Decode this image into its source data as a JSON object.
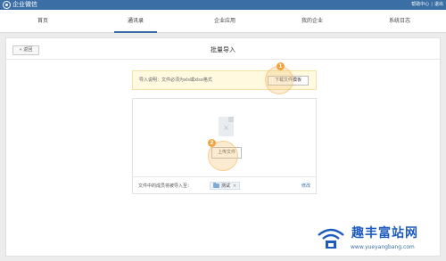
{
  "header": {
    "app_name": "企业微信",
    "links": {
      "help": "帮助中心",
      "separator": "|",
      "logout": "退出"
    }
  },
  "nav": {
    "items": [
      {
        "label": "首页"
      },
      {
        "label": "通讯录"
      },
      {
        "label": "企业应用"
      },
      {
        "label": "我的企业"
      },
      {
        "label": "系统日志"
      }
    ],
    "active_index": 1
  },
  "main": {
    "back_label": "« 返回",
    "title": "批量导入",
    "notice_text": "导入说明：文件必须为xls或xlsx格式",
    "download_template_label": "下载文件模板",
    "upload_label": "上传文件",
    "destination_label": "文件中的成员将被导入至：",
    "destination_tag": "测试",
    "destination_remove": "×",
    "modify_label": "修改",
    "file_icon_glyph": "×"
  },
  "annotations": [
    {
      "number": "1",
      "target": "download-template-button"
    },
    {
      "number": "2",
      "target": "upload-file-button"
    }
  ],
  "watermark": {
    "text": "趣丰富站网",
    "url": "www.yueyangbang.com"
  },
  "colors": {
    "primary": "#3a6ea5",
    "marker": "#f3a33a",
    "notice_bg": "#fff9e0",
    "watermark": "#1e5bbf"
  }
}
